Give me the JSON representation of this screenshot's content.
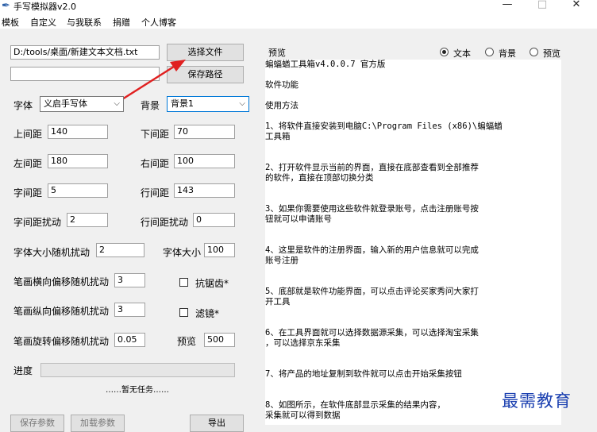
{
  "window": {
    "title": "手写模拟器v2.0",
    "controls": {
      "minimize": "—",
      "maximize": "□",
      "close": "✕"
    }
  },
  "menu": [
    "模板",
    "自定义",
    "与我联系",
    "捐赠",
    "个人博客"
  ],
  "file": {
    "path": "D:/tools/桌面/新建文本文档.txt",
    "save_path": "",
    "choose_file": "选择文件",
    "save_path_btn": "保存路径"
  },
  "font": {
    "label": "字体",
    "value": "义启手写体"
  },
  "background": {
    "label": "背景",
    "value": "背景1"
  },
  "fields": {
    "top_margin": {
      "label": "上间距",
      "value": "140"
    },
    "bottom_margin": {
      "label": "下间距",
      "value": "70"
    },
    "left_margin": {
      "label": "左间距",
      "value": "180"
    },
    "right_margin": {
      "label": "右间距",
      "value": "100"
    },
    "char_spacing": {
      "label": "字间距",
      "value": "5"
    },
    "line_spacing": {
      "label": "行间距",
      "value": "143"
    },
    "char_jitter": {
      "label": "字间距扰动",
      "value": "2"
    },
    "line_jitter": {
      "label": "行间距扰动",
      "value": "0"
    },
    "size_jitter": {
      "label": "字体大小随机扰动",
      "value": "2"
    },
    "font_size": {
      "label": "字体大小",
      "value": "100"
    },
    "h_offset": {
      "label": "笔画横向偏移随机扰动",
      "value": "3"
    },
    "v_offset": {
      "label": "笔画纵向偏移随机扰动",
      "value": "3"
    },
    "rotation": {
      "label": "笔画旋转偏移随机扰动",
      "value": "0.05"
    },
    "preview_size": {
      "label": "预览",
      "value": "500"
    }
  },
  "checks": {
    "antialias": "抗锯齿*",
    "filter": "滤镜*"
  },
  "progress": {
    "label": "进度",
    "status": "……暂无任务……",
    "value": 0
  },
  "buttons": {
    "save_params": "保存参数",
    "load_params": "加载参数",
    "export": "导出"
  },
  "preview": {
    "label": "预览",
    "modes": [
      {
        "label": "文本",
        "selected": true
      },
      {
        "label": "背景",
        "selected": false
      },
      {
        "label": "预览",
        "selected": false
      }
    ],
    "lines": [
      "    蝙蝠蝤工具箱v4.0.0.7 官方版",
      "",
      "    软件功能",
      "",
      "    使用方法",
      "",
      "    1、将软件直接安装到电脑C:\\Program Files (x86)\\蝙蝠蝤",
      "工具箱",
      "",
      "",
      "    2、打开软件显示当前的界面，直接在底部查看到全部推荐",
      "的软件，直接在顶部切换分类",
      "",
      "",
      "    3、如果你需要使用这些软件就登录账号，点击注册账号按",
      "钮就可以申请账号",
      "",
      "",
      "    4、这里是软件的注册界面，输入新的用户信息就可以完成",
      "账号注册",
      "",
      "",
      "    5、底部就是软件功能界面，可以点击评论买家秀问大家打",
      "开工具",
      "",
      "",
      "    6、在工具界面就可以选择数据源采集，可以选择淘宝采集",
      "，可以选择京东采集",
      "",
      "",
      "    7、将产品的地址复制到软件就可以点击开始采集按钮",
      "",
      "",
      "    8、如图所示，在软件底部显示采集的结果内容，",
      "采集就可以得到数据"
    ]
  },
  "watermark": "最需教育"
}
